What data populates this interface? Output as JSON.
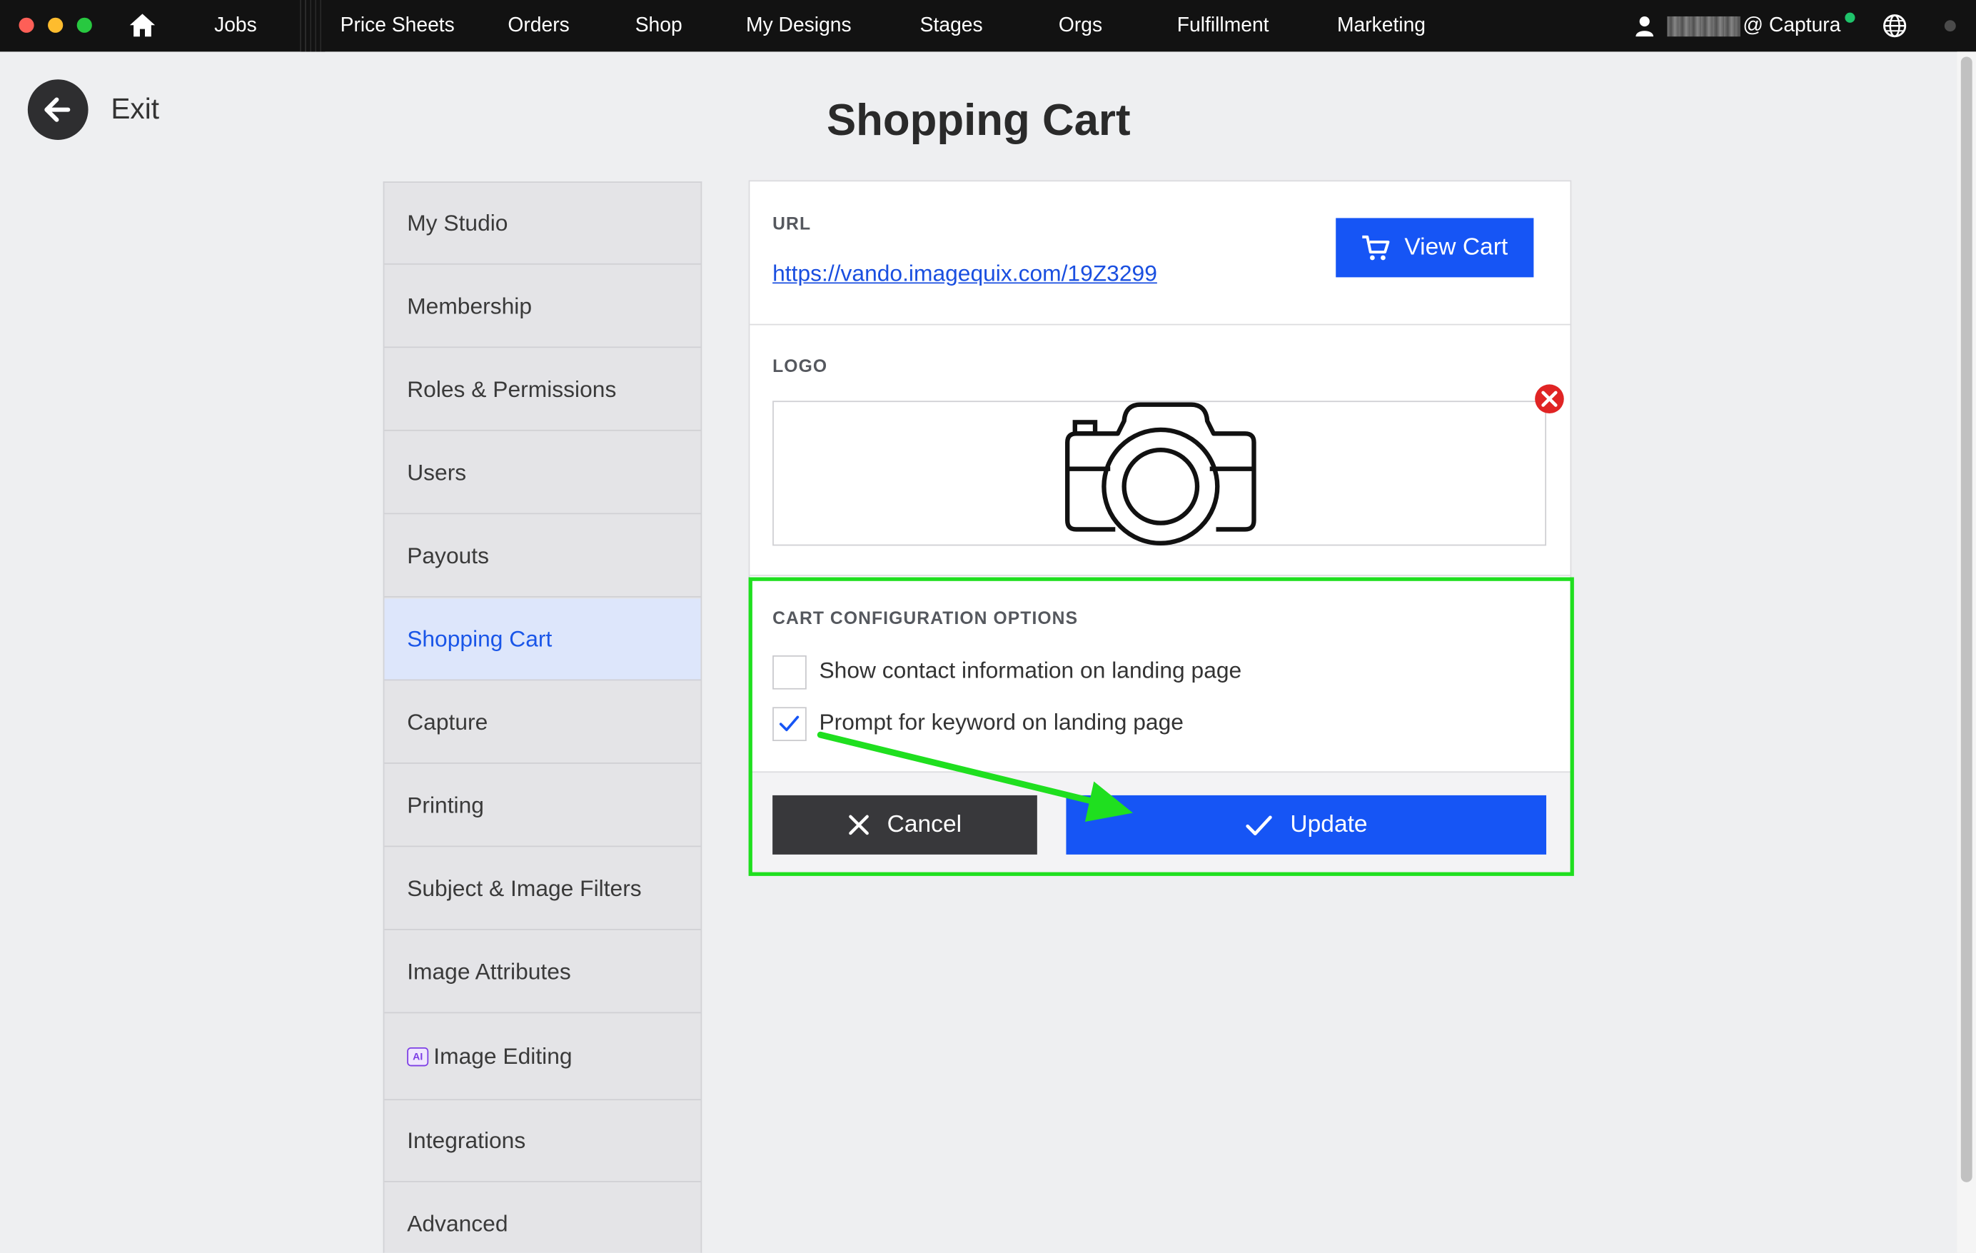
{
  "window": {
    "title": ""
  },
  "topnav": {
    "items": [
      "Jobs",
      "Price Sheets",
      "Orders",
      "Shop",
      "My Designs",
      "Stages",
      "Orgs",
      "Fulfillment",
      "Marketing"
    ],
    "user_org": "@ Captura"
  },
  "header": {
    "exit_label": "Exit",
    "page_title": "Shopping Cart"
  },
  "sidebar": {
    "items": [
      {
        "label": "My Studio"
      },
      {
        "label": "Membership"
      },
      {
        "label": "Roles & Permissions"
      },
      {
        "label": "Users"
      },
      {
        "label": "Payouts"
      },
      {
        "label": "Shopping Cart",
        "active": true
      },
      {
        "label": "Capture"
      },
      {
        "label": "Printing"
      },
      {
        "label": "Subject & Image Filters"
      },
      {
        "label": "Image Attributes"
      },
      {
        "label": "Image Editing",
        "badge": "AI"
      },
      {
        "label": "Integrations"
      },
      {
        "label": "Advanced"
      }
    ]
  },
  "url_section": {
    "label": "URL",
    "link": "https://vando.imagequix.com/19Z3299",
    "view_cart_label": "View Cart"
  },
  "logo_section": {
    "label": "LOGO",
    "image_icon": "camera-icon",
    "remove_icon": "close-circle-icon"
  },
  "cart_options": {
    "label": "CART CONFIGURATION OPTIONS",
    "options": [
      {
        "label": "Show contact information on landing page",
        "checked": false
      },
      {
        "label": "Prompt for keyword on landing page",
        "checked": true
      }
    ]
  },
  "actions": {
    "cancel_label": "Cancel",
    "update_label": "Update"
  },
  "colors": {
    "accent": "#1655f5",
    "highlight": "#1fdf1f",
    "dark_button": "#38383b",
    "remove": "#e02424"
  }
}
